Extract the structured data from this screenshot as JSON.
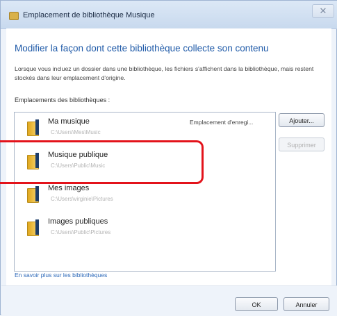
{
  "window": {
    "title": "Emplacement de bibliothèque Musique",
    "close_label": "✕"
  },
  "heading": "Modifier la façon dont cette bibliothèque collecte son contenu",
  "description": "Lorsque vous incluez un dossier dans une bibliothèque, les fichiers s'affichent dans la bibliothèque, mais restent stockés dans leur emplacement d'origine.",
  "locations_label": "Emplacements des bibliothèques :",
  "locations": [
    {
      "name": "Ma musique",
      "path": "C:\\Users\\Mes\\Music",
      "status": "Emplacement d'enregi...",
      "icon": "folder-icon"
    },
    {
      "name": "Musique publique",
      "path": "C:\\Users\\Public\\Music",
      "status": "",
      "icon": "folder-icon"
    },
    {
      "name": "Mes images",
      "path": "C:\\Users\\virginie\\Pictures",
      "status": "",
      "icon": "folder-icon"
    },
    {
      "name": "Images publiques",
      "path": "C:\\Users\\Public\\Pictures",
      "status": "",
      "icon": "folder-icon"
    }
  ],
  "buttons": {
    "add": "Ajouter...",
    "remove": "Supprimer",
    "ok": "OK",
    "cancel": "Annuler"
  },
  "learn_more_link": "En savoir plus sur les bibliothèques",
  "colors": {
    "heading": "#1f5aa8",
    "link": "#2a67b8",
    "highlight": "#e3131b"
  }
}
